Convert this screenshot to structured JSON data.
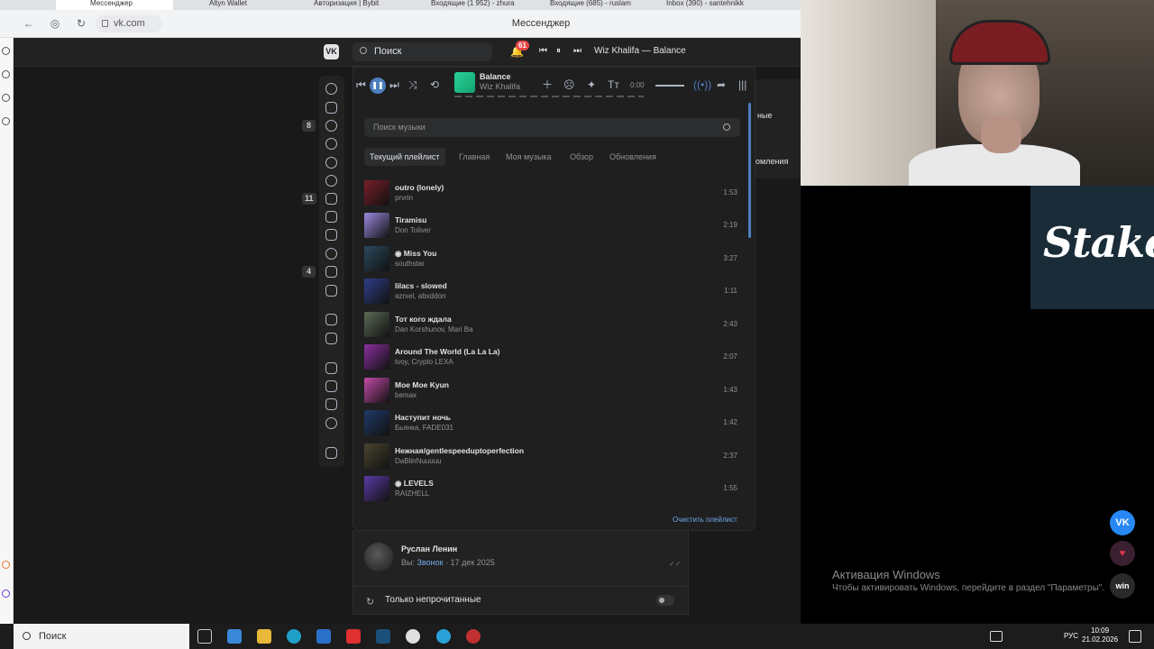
{
  "browser": {
    "tabs": [
      {
        "label": "Мессенджер",
        "active": true
      },
      {
        "label": "Altyn Wallet"
      },
      {
        "label": "Авторизация | Bybit"
      },
      {
        "label": "Входящие (1 952) - zhura"
      },
      {
        "label": "Входящие (685) - ruslam"
      },
      {
        "label": "Inbox (390) - santehnikk"
      }
    ],
    "url": "vk.com",
    "page_title": "Мессенджер"
  },
  "vk_header": {
    "logo": "VK",
    "search_placeholder": "Поиск",
    "notifications_count": "61",
    "now_playing": "Wiz Khalifa — Balance"
  },
  "left_nav_badges": {
    "messages": "8",
    "photos": "11",
    "games": "4"
  },
  "right_fragment": {
    "text1": "ные",
    "text2": "омления"
  },
  "player": {
    "track_title": "Balance",
    "track_artist": "Wiz Khalifa",
    "time": "0:00",
    "search_placeholder": "Поиск музыки",
    "tabs": [
      {
        "label": "Текущий плейлист",
        "active": true
      },
      {
        "label": "Главная"
      },
      {
        "label": "Моя музыка"
      },
      {
        "label": "Обзор"
      },
      {
        "label": "Обновления"
      }
    ],
    "tracks": [
      {
        "title": "outro (lonely)",
        "artist": "prvrin",
        "duration": "1:53",
        "color": "#7a1f2a"
      },
      {
        "title": "Tiramisu",
        "artist": "Don Toliver",
        "duration": "2:19",
        "color": "#9d8ae0"
      },
      {
        "title": "◉ Miss You",
        "artist": "southstar",
        "duration": "3:27",
        "color": "#2b4a5e"
      },
      {
        "title": "lilacs - slowed",
        "artist": "azrxel, abxddon",
        "duration": "1:11",
        "color": "#2f3f8a"
      },
      {
        "title": "Тот кого ждала",
        "artist": "Dan Korshunov, Mari Ba",
        "duration": "2:43",
        "color": "#5b6b55"
      },
      {
        "title": "Around The World (La La La)",
        "artist": "tvoy, Crypto LEXA",
        "duration": "2:07",
        "color": "#8a2fa0"
      },
      {
        "title": "Moe Moe Kyun",
        "artist": "bemax",
        "duration": "1:43",
        "color": "#c24aa8"
      },
      {
        "title": "Наступит ночь",
        "artist": "Бьянка, FADE031",
        "duration": "1:42",
        "color": "#1f3a6a"
      },
      {
        "title": "Нежная/gentlespeeduptoperfection",
        "artist": "DaBlinNuuuuu",
        "duration": "2:37",
        "color": "#4a4530"
      },
      {
        "title": "◉ LEVELS",
        "artist": "RAIZHELL",
        "duration": "1:55",
        "color": "#5a3aa8"
      }
    ],
    "clear_link": "Очистить плейлист"
  },
  "chat": {
    "name": "Руслан Ленин",
    "prefix": "Вы:",
    "link": "Звонок",
    "date": "· 17 дек 2025",
    "unread_only": "Только непрочитанные"
  },
  "stake": {
    "logo": "Stake"
  },
  "windows_watermark": {
    "title": "Активация Windows",
    "subtitle": "Чтобы активировать Windows, перейдите в раздел \"Параметры\"."
  },
  "taskbar": {
    "search_placeholder": "Поиск",
    "lang": "РУС",
    "time": "10:09",
    "date": "21.02.2026"
  }
}
